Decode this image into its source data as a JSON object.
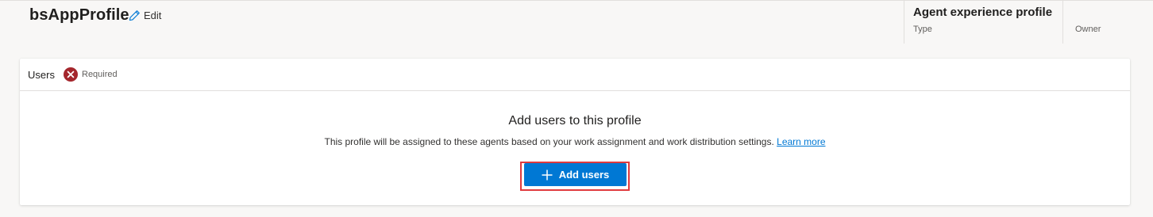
{
  "profile": {
    "name": "bsAppProfile",
    "edit_label": "Edit",
    "type_value": "Agent experience profile",
    "type_label": "Type",
    "owner_label": "Owner"
  },
  "users_section": {
    "title": "Users",
    "required_text": "Required",
    "empty_title": "Add users to this profile",
    "empty_description": "This profile will be assigned to these agents based on your work assignment and work distribution settings.",
    "learn_more": "Learn more",
    "add_button": "Add users"
  },
  "icons": {
    "edit": "pencil-icon",
    "required": "error-circle-icon",
    "add": "plus-icon"
  },
  "colors": {
    "primary": "#0078d4",
    "required": "#a4262c",
    "highlight": "#e03a3e",
    "page_bg": "#f8f7f6"
  }
}
